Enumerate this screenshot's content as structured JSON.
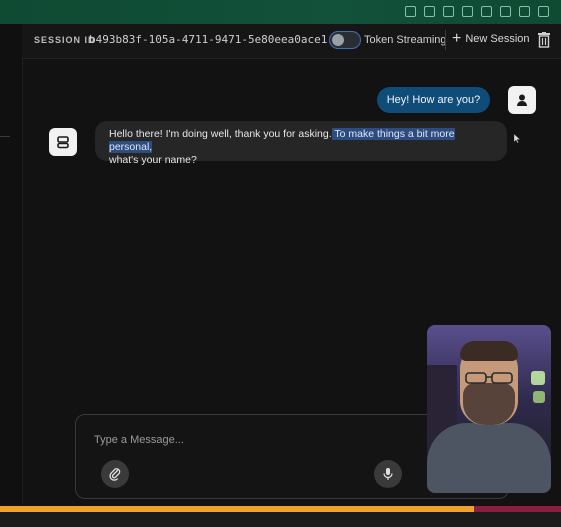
{
  "header": {
    "session_label": "SESSION ID",
    "session_id": "b493b83f-105a-4711-9471-5e80eea0ace1",
    "toggle_label": "Token Streaming",
    "toggle_on": false,
    "new_session_label": "New Session",
    "new_session_icon": "plus-icon",
    "delete_icon": "trash-icon"
  },
  "messages": {
    "user": {
      "text": "Hey! How are you?",
      "avatar_icon": "user-icon"
    },
    "bot": {
      "text_a": "Hello there! I'm doing well, thank you for asking.",
      "text_b": " To make things a bit more personal,",
      "text_c": "what's your name?",
      "avatar_icon": "robot-icon"
    }
  },
  "composer": {
    "placeholder": "Type a Message...",
    "attach_icon": "paperclip-icon",
    "mic_icon": "microphone-icon"
  },
  "progress": {
    "fraction": 0.845
  },
  "colors": {
    "accent_user_bubble": "#0f4c78",
    "highlight": "#2f4c7e",
    "progress_fill": "#f2a22b",
    "progress_rest": "#8c1d3f",
    "top_strip": "#0f4a33"
  }
}
